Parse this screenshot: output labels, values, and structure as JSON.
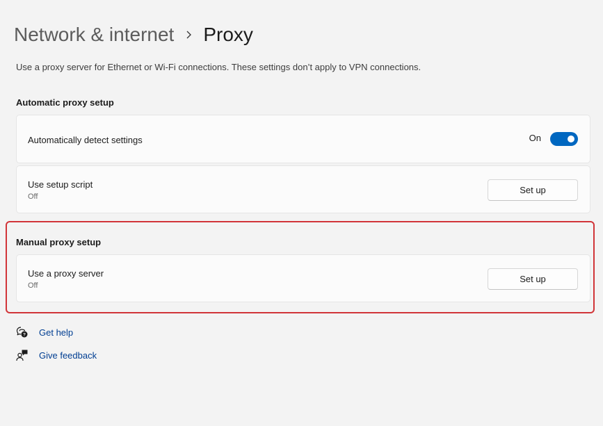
{
  "breadcrumb": {
    "parent": "Network & internet",
    "separator_icon": "chevron-right-icon",
    "current": "Proxy"
  },
  "description": "Use a proxy server for Ethernet or Wi-Fi connections. These settings don’t apply to VPN connections.",
  "automatic": {
    "title": "Automatic proxy setup",
    "detect": {
      "label": "Automatically detect settings",
      "state_text": "On",
      "toggle_on": true
    },
    "script": {
      "label": "Use setup script",
      "status": "Off",
      "button": "Set up"
    }
  },
  "manual": {
    "title": "Manual proxy setup",
    "proxy": {
      "label": "Use a proxy server",
      "status": "Off",
      "button": "Set up"
    }
  },
  "links": {
    "help": {
      "label": "Get help",
      "icon": "help-chat-icon"
    },
    "feedback": {
      "label": "Give feedback",
      "icon": "feedback-person-icon"
    }
  },
  "colors": {
    "accent": "#0067c0",
    "highlight": "#d13438",
    "link": "#003e92",
    "background": "#f3f3f3"
  }
}
